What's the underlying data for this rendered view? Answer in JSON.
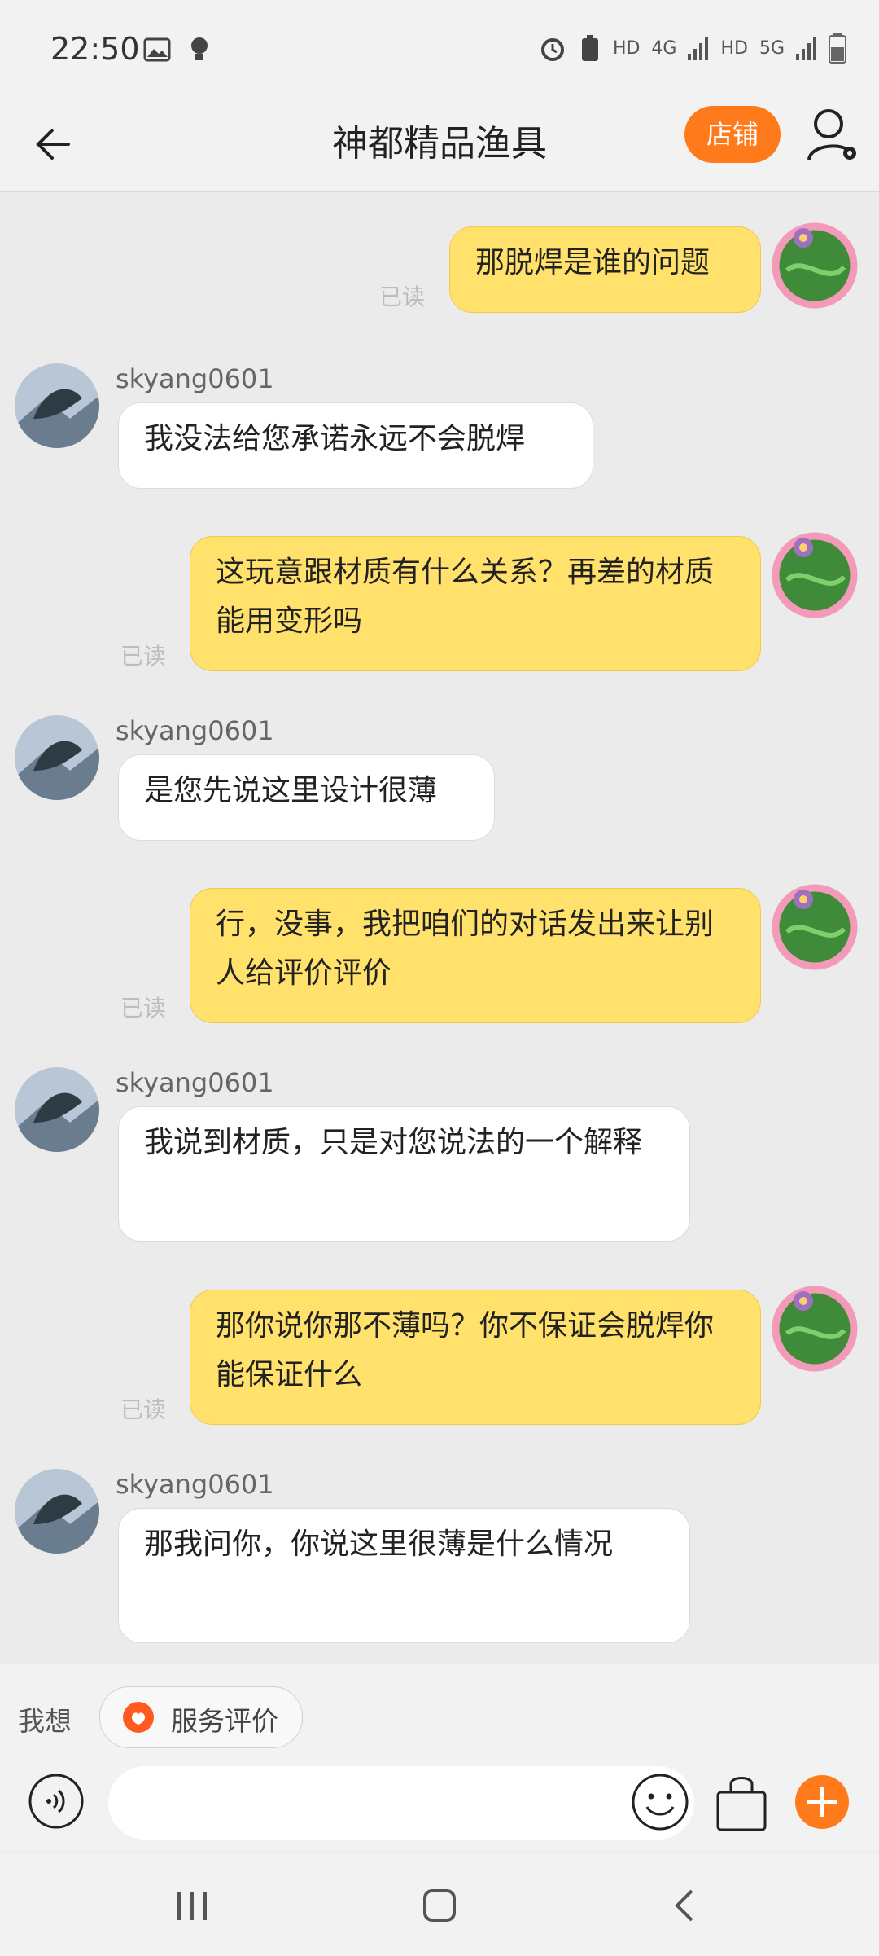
{
  "status_bar": {
    "time": "22:50",
    "signal_labels": [
      "HD",
      "4G",
      "HD",
      "5G"
    ],
    "left_icons": [
      "image-icon",
      "bulb-icon"
    ],
    "right_icons": [
      "alarm-icon",
      "battery-saver-icon",
      "signal-icon",
      "battery-icon"
    ]
  },
  "header": {
    "title": "神都精品渔具",
    "store_button": "店铺",
    "back_icon": "back-arrow-icon",
    "settings_icon": "user-settings-icon"
  },
  "messages": [
    {
      "side": "me",
      "text": "那脱焊是谁的问题",
      "read": "已读"
    },
    {
      "side": "them",
      "sender": "skyang0601",
      "text": "我没法给您承诺永远不会脱焊"
    },
    {
      "side": "me",
      "text": "这玩意跟材质有什么关系？再差的材质能用变形吗",
      "read": "已读"
    },
    {
      "side": "them",
      "sender": "skyang0601",
      "text": "是您先说这里设计很薄"
    },
    {
      "side": "me",
      "text": "行，没事，我把咱们的对话发出来让别人给评价评价",
      "read": "已读"
    },
    {
      "side": "them",
      "sender": "skyang0601",
      "text": "我说到材质，只是对您说法的一个解释"
    },
    {
      "side": "me",
      "text": "那你说你那不薄吗？你不保证会脱焊你能保证什么",
      "read": "已读"
    },
    {
      "side": "them",
      "sender": "skyang0601",
      "text": "那我问你，你说这里很薄是什么情况"
    }
  ],
  "suggest": {
    "label": "我想",
    "chip_label": "服务评价",
    "chip_icon": "service-rating-icon"
  },
  "input_bar": {
    "placeholder": "",
    "value": "",
    "icons": [
      "voice-icon",
      "emoji-icon",
      "shopping-bag-icon",
      "plus-icon"
    ]
  },
  "nav": {
    "icons": [
      "recents-icon",
      "home-icon",
      "back-icon"
    ]
  },
  "colors": {
    "accent": "#ff7a1a",
    "my_bubble": "#ffe16b",
    "their_bubble": "#ffffff",
    "background": "#ebebeb"
  }
}
